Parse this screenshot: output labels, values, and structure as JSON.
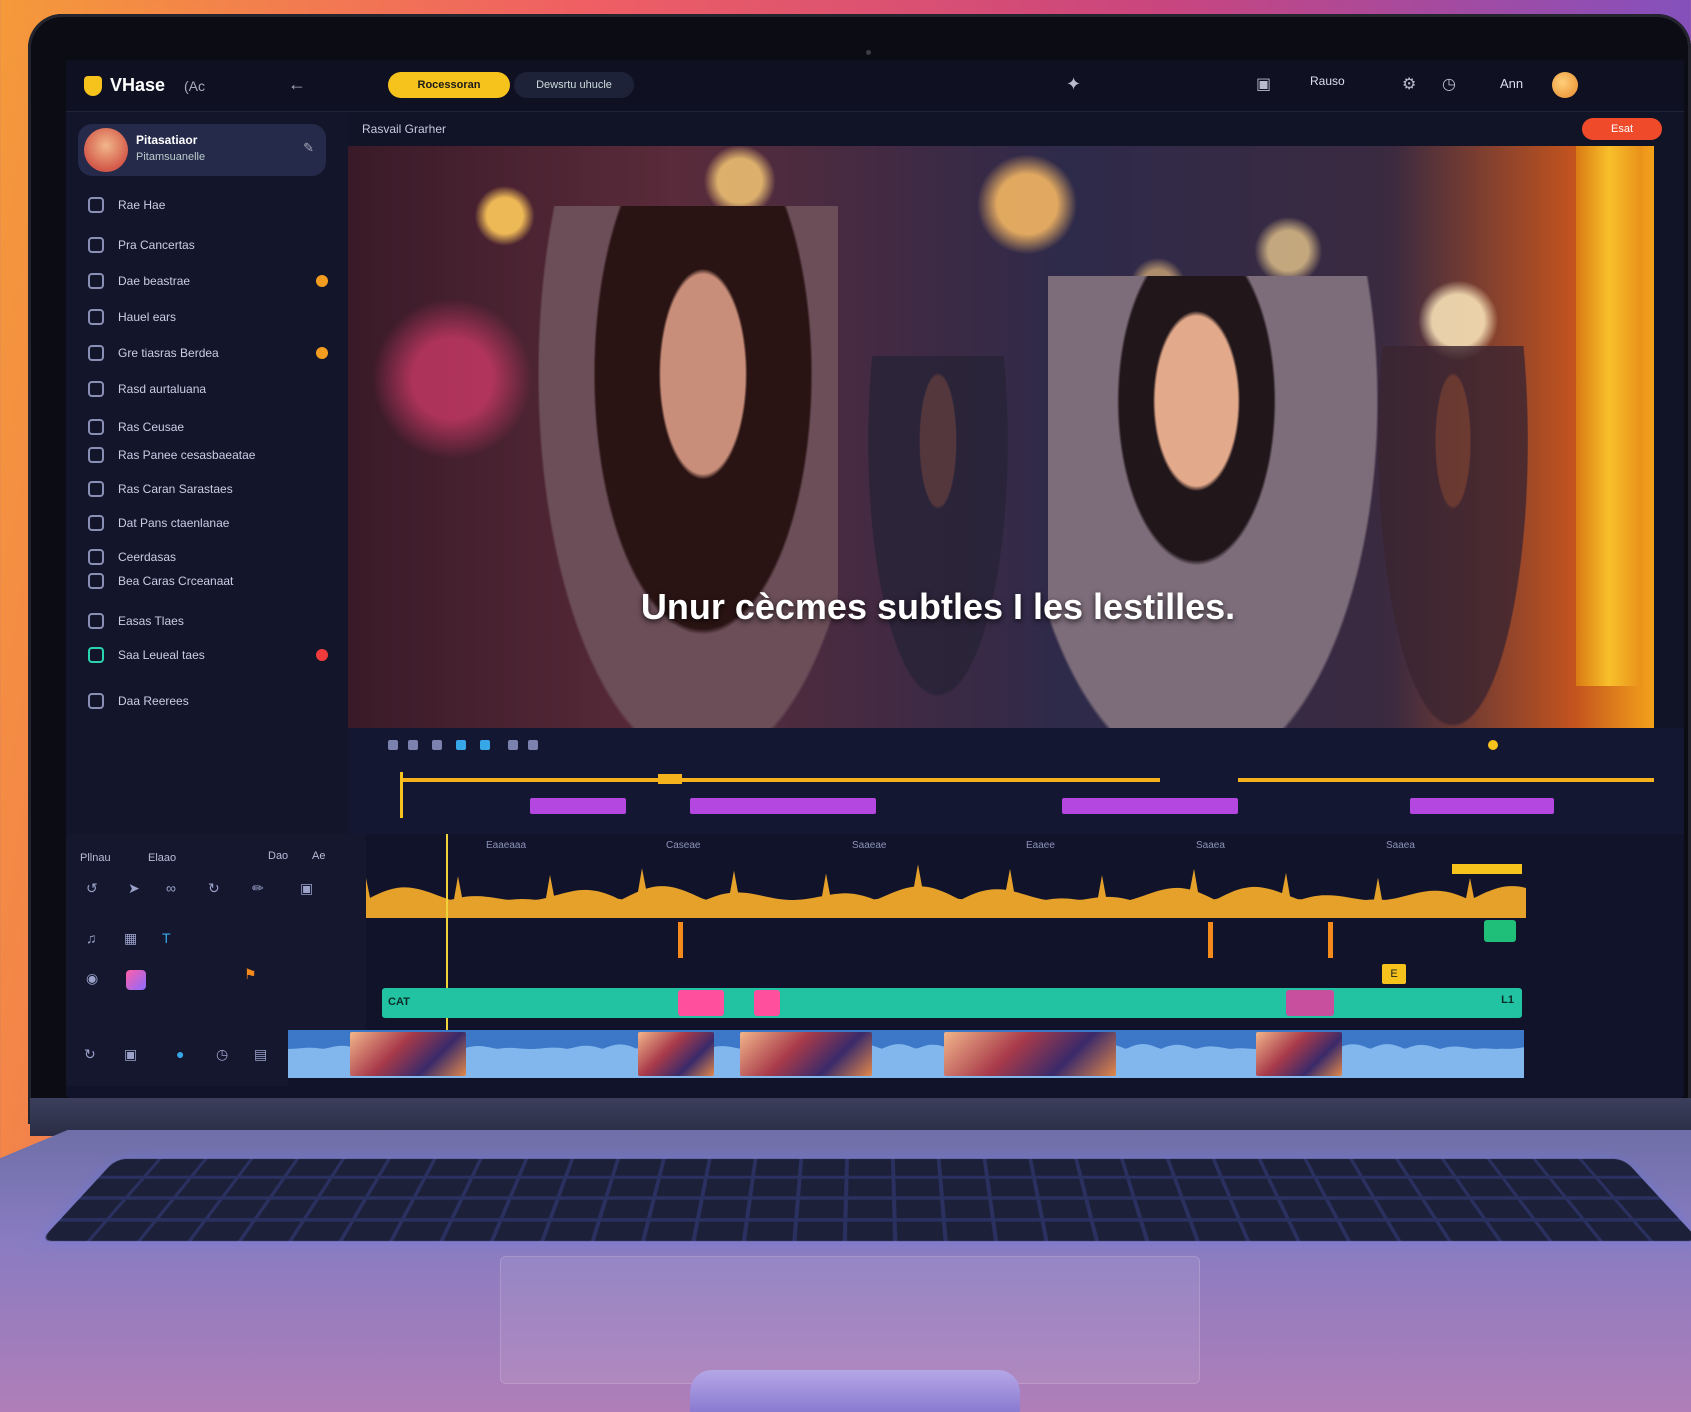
{
  "app": {
    "name": "VHase",
    "sub": "(Ac",
    "tabs": [
      "Rocessoran",
      "Dewsrtu uhucle"
    ]
  },
  "topbar": {
    "user_label": "Ann",
    "right_text": "Rauso"
  },
  "sidebar": {
    "profile": {
      "name": "Pitasatiaor",
      "subtitle": "Pitamsuanelle"
    },
    "items": [
      {
        "label": "Rae Hae",
        "badge": ""
      },
      {
        "label": "Pra Cancertas",
        "badge": ""
      },
      {
        "label": "Dae beastrae",
        "badge": "#f39c1f"
      },
      {
        "label": "Hauel ears",
        "badge": ""
      },
      {
        "label": "Gre tiasras Berdea",
        "badge": "#f39c1f"
      },
      {
        "label": "Rasd aurtaluana",
        "badge": ""
      },
      {
        "label": "Ras Ceusae",
        "badge": ""
      },
      {
        "label": "Ras Panee cesasbaeatae",
        "badge": ""
      },
      {
        "label": "Ras Caran Sarastaes",
        "badge": ""
      },
      {
        "label": "Dat Pans ctaenlanae",
        "badge": ""
      },
      {
        "label": "Ceerdasas",
        "badge": ""
      },
      {
        "label": "Bea Caras Crceanaat",
        "badge": ""
      },
      {
        "label": "Easas Tlaes",
        "badge": ""
      },
      {
        "label": "Saa Leueal taes",
        "badge": "#ef3b3b"
      },
      {
        "label": "Daa Reerees",
        "badge": ""
      }
    ]
  },
  "preview": {
    "title": "Rasvail Grarher",
    "export_label": "Esat",
    "subtitle_text": "Unur cècmes subtles I les lestilles."
  },
  "tools": {
    "label_a": "Pllnau",
    "label_b": "Elaao",
    "label_c": "Dao",
    "label_d": "Ae"
  },
  "ruler": {
    "labels": [
      "Eaaeaaa",
      "Caseae",
      "Saaeae",
      "Eaaee",
      "Saaea",
      "Saaea"
    ]
  },
  "timeline": {
    "track_label": "CAT",
    "end_label": "L1",
    "tag": "E"
  }
}
